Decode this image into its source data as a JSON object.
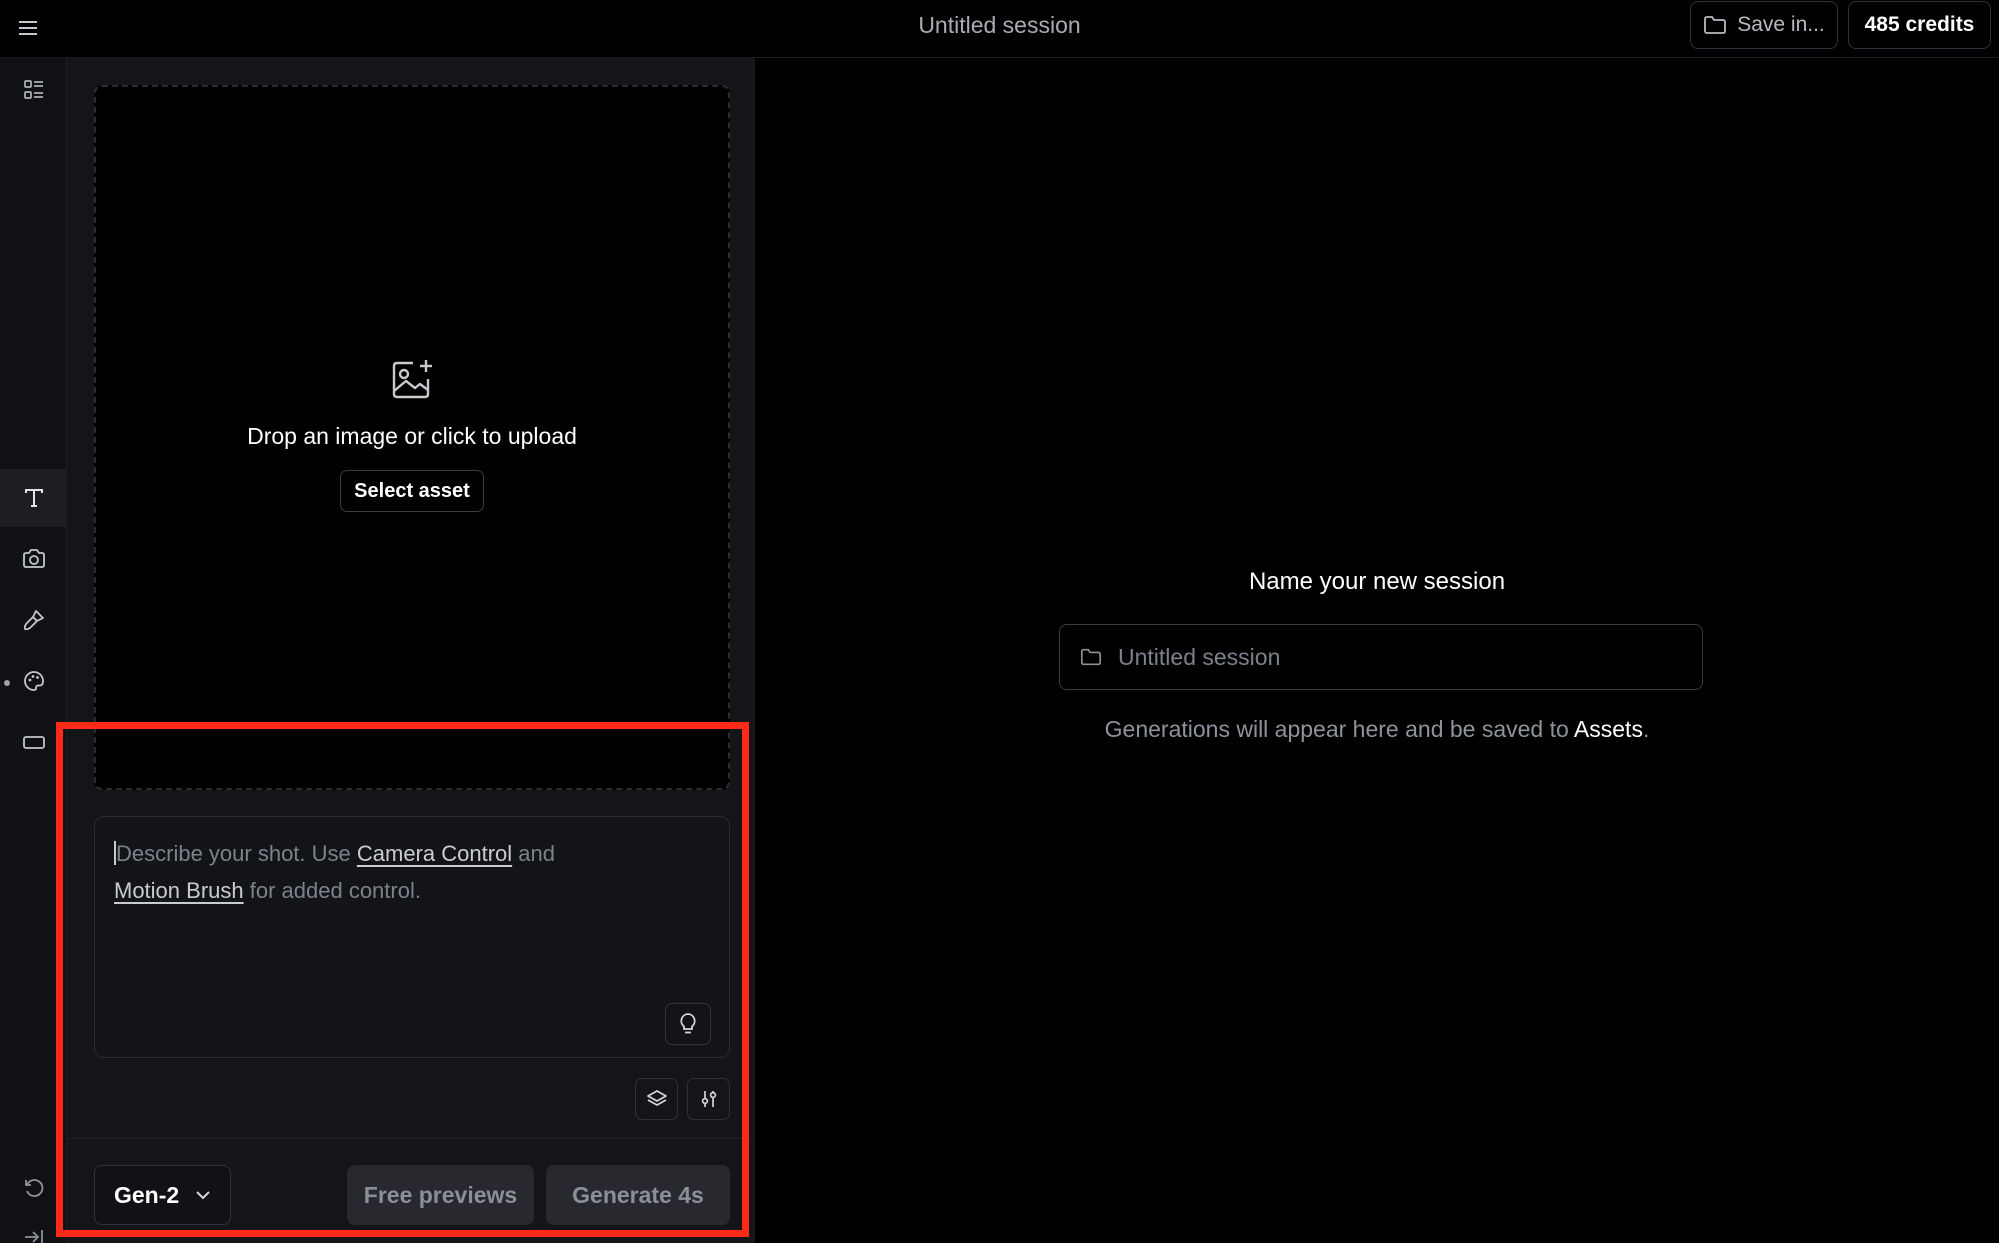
{
  "header": {
    "title": "Untitled session",
    "save_label": "Save in...",
    "credits_label": "485 credits"
  },
  "rail": {
    "items": [
      {
        "name": "assets",
        "icon": "list-grid-icon"
      },
      {
        "name": "text",
        "icon": "text-t-icon",
        "active": true
      },
      {
        "name": "camera-control",
        "icon": "camera-icon"
      },
      {
        "name": "motion-brush",
        "icon": "brush-icon"
      },
      {
        "name": "style",
        "icon": "palette-icon"
      },
      {
        "name": "aspect-ratio",
        "icon": "rectangle-icon"
      },
      {
        "name": "undo",
        "icon": "undo-icon"
      },
      {
        "name": "collapse",
        "icon": "arrow-to-right-icon"
      }
    ]
  },
  "upload": {
    "drop_text": "Drop an image or click to upload",
    "select_asset_label": "Select asset"
  },
  "prompt": {
    "text_part1": "Describe your shot. Use ",
    "link_camera": "Camera Control",
    "text_part2": " and ",
    "link_motion": "Motion Brush",
    "text_part3": " for added control."
  },
  "footer": {
    "model": "Gen-2",
    "free_previews_label": "Free previews",
    "generate_label": "Generate 4s"
  },
  "main": {
    "name_label": "Name your new session",
    "name_placeholder": "Untitled session",
    "note_prefix": "Generations will appear here and be saved to ",
    "note_link": "Assets",
    "note_suffix": "."
  },
  "colors": {
    "highlight": "#ff2a17",
    "background": "#000000",
    "panel": "#141518"
  }
}
